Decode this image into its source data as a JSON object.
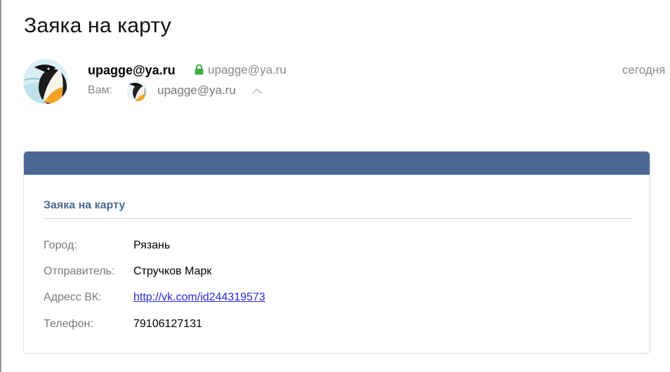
{
  "email": {
    "subject": "Заяка на карту",
    "from": {
      "name": "upagge@ya.ru",
      "address": "upagge@ya.ru",
      "avatar_icon": "penguin-avatar-icon",
      "verified_icon": "lock-icon"
    },
    "to": {
      "label": "Вам:",
      "address": "upagge@ya.ru"
    },
    "date": "сегодня"
  },
  "card": {
    "title": "Заяка на карту",
    "rows": [
      {
        "label": "Город:",
        "value": "Рязань"
      },
      {
        "label": "Отправитель:",
        "value": "Стручков Марк"
      },
      {
        "label": "Адресс ВК:",
        "value": "http://vk.com/id244319573"
      },
      {
        "label": "Телефон:",
        "value": "79106127131"
      }
    ]
  },
  "colors": {
    "accent": "#4a6893",
    "lock": "#3fae49",
    "link": "#2a2ad0"
  }
}
